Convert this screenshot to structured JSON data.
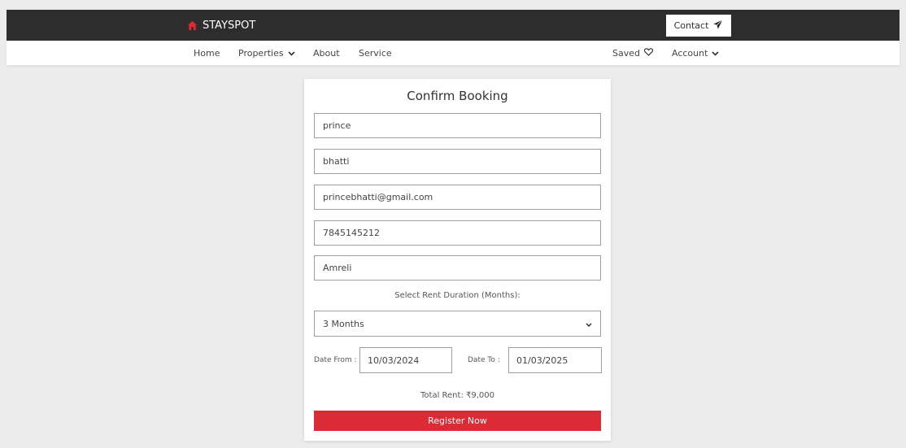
{
  "header": {
    "brand": "STAYSPOT",
    "contact_label": "Contact"
  },
  "nav": {
    "home": "Home",
    "properties": "Properties",
    "about": "About",
    "service": "Service",
    "saved": "Saved",
    "account": "Account"
  },
  "form": {
    "title": "Confirm Booking",
    "first_name": "prince",
    "last_name": "bhatti",
    "email": "princebhatti@gmail.com",
    "phone": "7845145212",
    "city": "Amreli",
    "duration_label": "Select Rent Duration (Months):",
    "duration_value": "3 Months",
    "date_from_label": "Date From :",
    "date_from": "10/03/2024",
    "date_to_label": "Date To :",
    "date_to": "01/03/2025",
    "total_rent": "Total Rent: ₹9,000",
    "submit_label": "Register Now"
  },
  "colors": {
    "accent": "#dc2b34",
    "topbar": "#2d2d2d",
    "background": "#ececec"
  }
}
